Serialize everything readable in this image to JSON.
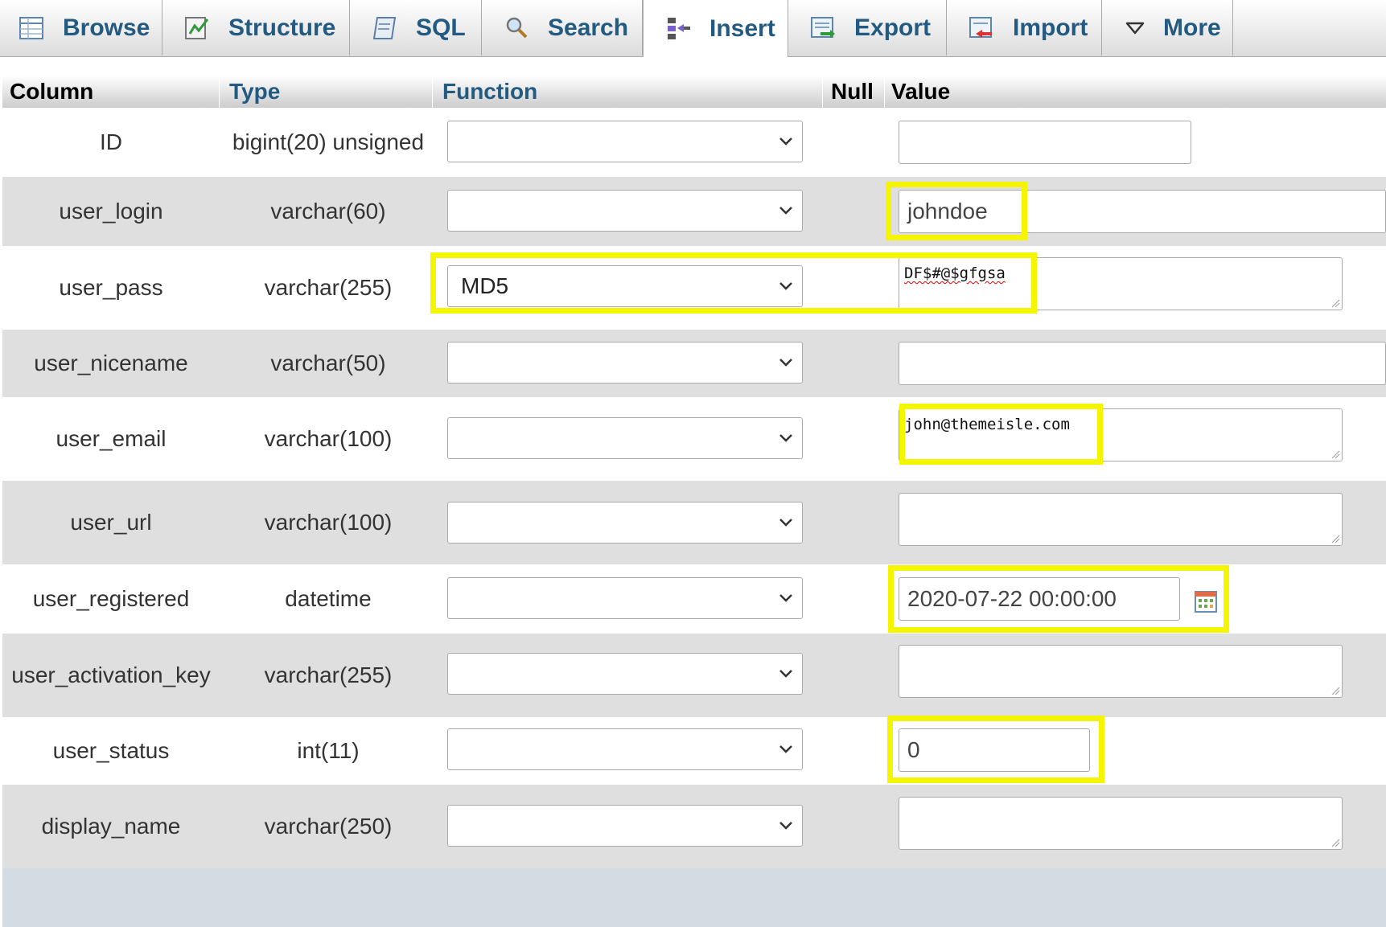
{
  "tabs": [
    {
      "label": "Browse",
      "icon": "browse-icon"
    },
    {
      "label": "Structure",
      "icon": "structure-icon"
    },
    {
      "label": "SQL",
      "icon": "sql-icon"
    },
    {
      "label": "Search",
      "icon": "search-icon"
    },
    {
      "label": "Insert",
      "icon": "insert-icon",
      "active": true
    },
    {
      "label": "Export",
      "icon": "export-icon"
    },
    {
      "label": "Import",
      "icon": "import-icon"
    },
    {
      "label": "More",
      "icon": "triangle-down-icon"
    }
  ],
  "table": {
    "headers": {
      "column": "Column",
      "type": "Type",
      "function": "Function",
      "null": "Null",
      "value": "Value"
    },
    "rows": [
      {
        "column": "ID",
        "type": "bigint(20) unsigned",
        "function": "",
        "value": ""
      },
      {
        "column": "user_login",
        "type": "varchar(60)",
        "function": "",
        "value": "johndoe"
      },
      {
        "column": "user_pass",
        "type": "varchar(255)",
        "function": "MD5",
        "value": "DF$#@$gfgsa"
      },
      {
        "column": "user_nicename",
        "type": "varchar(50)",
        "function": "",
        "value": ""
      },
      {
        "column": "user_email",
        "type": "varchar(100)",
        "function": "",
        "value": "john@themeisle.com"
      },
      {
        "column": "user_url",
        "type": "varchar(100)",
        "function": "",
        "value": ""
      },
      {
        "column": "user_registered",
        "type": "datetime",
        "function": "",
        "value": "2020-07-22 00:00:00"
      },
      {
        "column": "user_activation_key",
        "type": "varchar(255)",
        "function": "",
        "value": ""
      },
      {
        "column": "user_status",
        "type": "int(11)",
        "function": "",
        "value": "0"
      },
      {
        "column": "display_name",
        "type": "varchar(250)",
        "function": "",
        "value": ""
      }
    ]
  },
  "colors": {
    "highlight": "#f5f500",
    "link": "#235a81",
    "row_alt": "#dfdfdf",
    "footer": "#d3dce3"
  }
}
